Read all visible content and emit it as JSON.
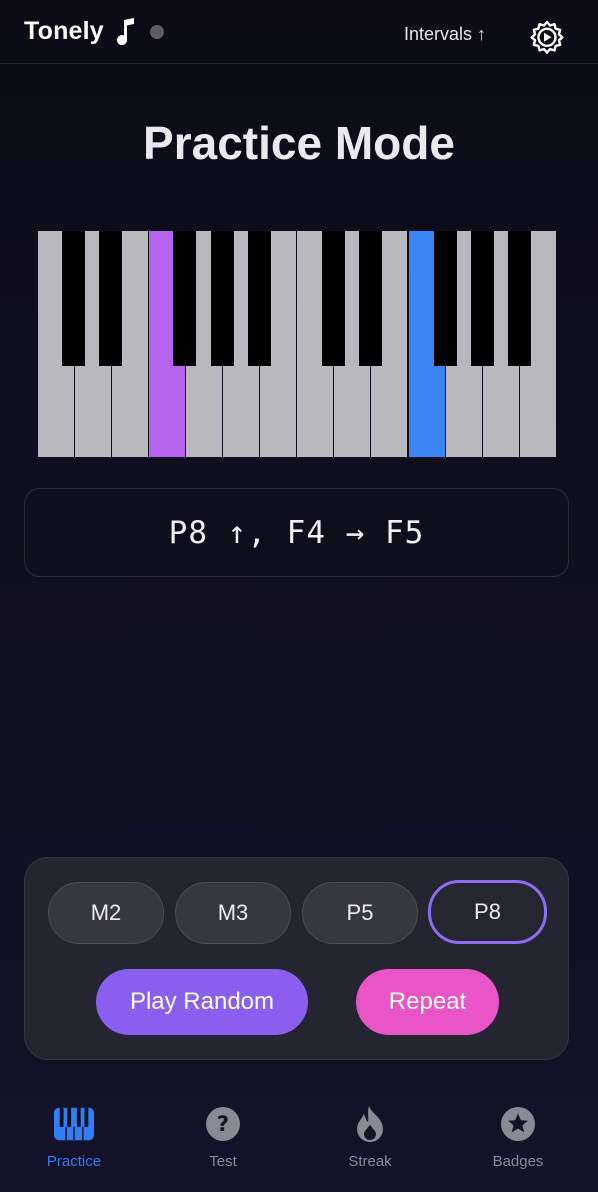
{
  "header": {
    "app_title": "Tonely",
    "mode_label": "Intervals ↑",
    "icons": [
      "music-note-icon",
      "status-dot",
      "gear-icon"
    ]
  },
  "page": {
    "title": "Practice Mode"
  },
  "piano": {
    "highlighted_keys": [
      {
        "key": "F4",
        "color": "#b562ee"
      },
      {
        "key": "F5",
        "color": "#3a86f7"
      }
    ]
  },
  "readout": {
    "text": "P8 ↑, F4 → F5"
  },
  "controls": {
    "intervals": [
      {
        "label": "M2",
        "selected": false
      },
      {
        "label": "M3",
        "selected": false
      },
      {
        "label": "P5",
        "selected": false
      },
      {
        "label": "P8",
        "selected": true
      }
    ],
    "play_random_label": "Play Random",
    "repeat_label": "Repeat"
  },
  "tabs": [
    {
      "label": "Practice",
      "icon": "piano-icon",
      "active": true
    },
    {
      "label": "Test",
      "icon": "question-icon",
      "active": false
    },
    {
      "label": "Streak",
      "icon": "flame-icon",
      "active": false
    },
    {
      "label": "Badges",
      "icon": "star-badge-icon",
      "active": false
    }
  ],
  "colors": {
    "background": "#0e0d1c",
    "accent_purple": "#8a5fef",
    "accent_pink": "#e954c6",
    "active_tab": "#2f7ef5"
  }
}
